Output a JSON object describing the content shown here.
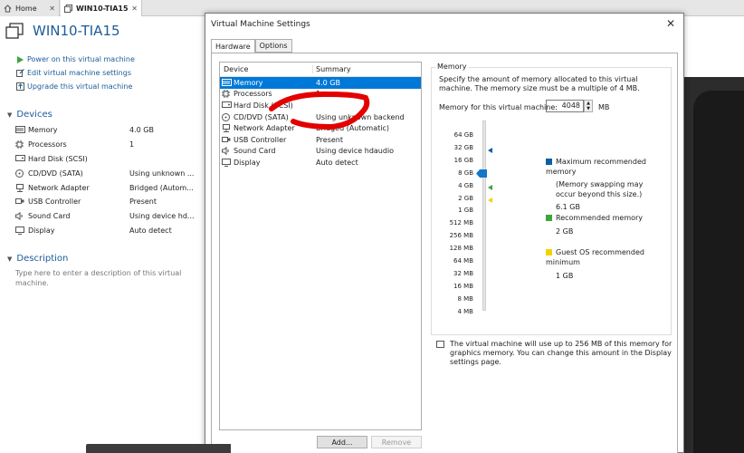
{
  "tabs": [
    {
      "label": "Home"
    },
    {
      "label": "WIN10-TIA15"
    }
  ],
  "vm": {
    "title": "WIN10-TIA15",
    "actions": [
      {
        "label": "Power on this virtual machine",
        "icon": "play-icon"
      },
      {
        "label": "Edit virtual machine settings",
        "icon": "edit-icon"
      },
      {
        "label": "Upgrade this virtual machine",
        "icon": "upgrade-icon"
      }
    ],
    "devices_heading": "Devices",
    "devices": [
      {
        "name": "Memory",
        "value": "4.0 GB"
      },
      {
        "name": "Processors",
        "value": "1"
      },
      {
        "name": "Hard Disk (SCSI)",
        "value": ""
      },
      {
        "name": "CD/DVD (SATA)",
        "value": "Using unknown ..."
      },
      {
        "name": "Network Adapter",
        "value": "Bridged (Autom..."
      },
      {
        "name": "USB Controller",
        "value": "Present"
      },
      {
        "name": "Sound Card",
        "value": "Using device hd..."
      },
      {
        "name": "Display",
        "value": "Auto detect"
      }
    ],
    "description_heading": "Description",
    "description_placeholder": "Type here to enter a description of this virtual machine."
  },
  "dialog": {
    "title": "Virtual Machine Settings",
    "close": "✕",
    "tabs": [
      {
        "label": "Hardware"
      },
      {
        "label": "Options"
      }
    ],
    "table": {
      "col_device": "Device",
      "col_summary": "Summary",
      "rows": [
        {
          "device": "Memory",
          "summary": "4.0 GB",
          "selected": true
        },
        {
          "device": "Processors",
          "summary": "1"
        },
        {
          "device": "Hard Disk (SCSI)",
          "summary": ""
        },
        {
          "device": "CD/DVD (SATA)",
          "summary": "Using unknown backend"
        },
        {
          "device": "Network Adapter",
          "summary": "Bridged (Automatic)"
        },
        {
          "device": "USB Controller",
          "summary": "Present"
        },
        {
          "device": "Sound Card",
          "summary": "Using device hdaudio"
        },
        {
          "device": "Display",
          "summary": "Auto detect"
        }
      ]
    },
    "add_button": "Add...",
    "remove_button": "Remove",
    "memory": {
      "group_label": "Memory",
      "description": "Specify the amount of memory allocated to this virtual machine. The memory size must be a multiple of 4 MB.",
      "field_label": "Memory for this virtual machine:",
      "field_value": "4048",
      "unit": "MB",
      "scale": [
        "64 GB",
        "32 GB",
        "16 GB",
        "8 GB",
        "4 GB",
        "2 GB",
        "1 GB",
        "512 MB",
        "256 MB",
        "128 MB",
        "64 MB",
        "32 MB",
        "16 MB",
        "8 MB",
        "4 MB"
      ],
      "slider_value": "4048 MB",
      "legend": {
        "max_label": "Maximum recommended memory",
        "max_note": "(Memory swapping may occur beyond this size.)",
        "max_value": "6.1 GB",
        "rec_label": "Recommended memory",
        "rec_value": "2 GB",
        "min_label": "Guest OS recommended minimum",
        "min_value": "1 GB"
      },
      "colors": {
        "max": "#0b5fa5",
        "rec": "#3ea53a",
        "min": "#f2d200"
      }
    },
    "info": "The virtual machine will use up to 256 MB of this memory for graphics memory. You can change this amount in the Display settings page."
  }
}
